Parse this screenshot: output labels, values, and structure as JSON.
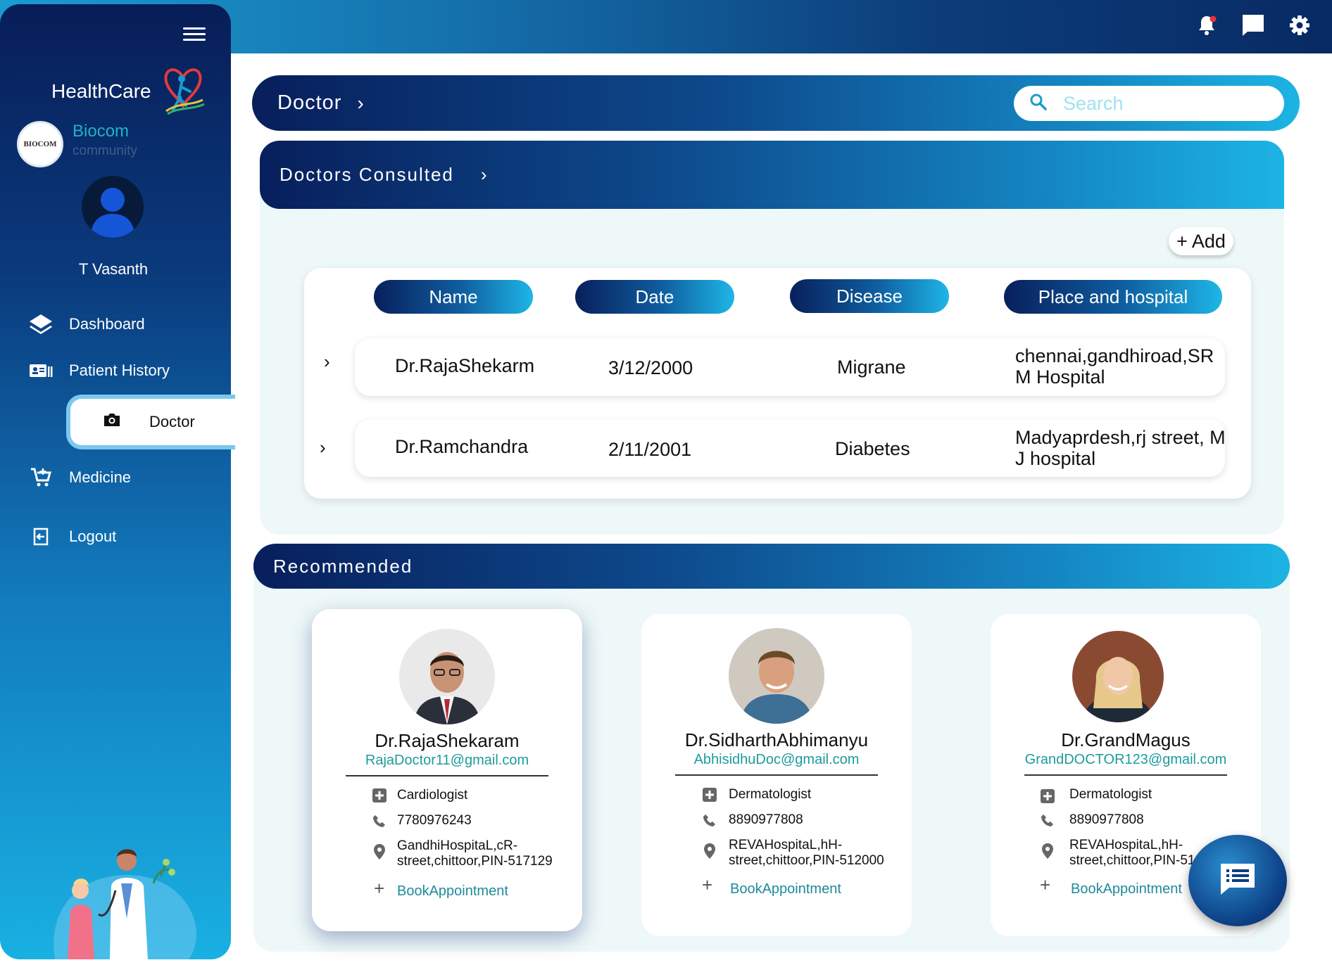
{
  "sidebar": {
    "brand": "HealthCare",
    "org_logo_text": "BIOCOM",
    "org_name": "Biocom",
    "org_sub": "community",
    "user_name": "T Vasanth",
    "nav": [
      {
        "label": "Dashboard",
        "icon": "layers-icon"
      },
      {
        "label": "Patient History",
        "icon": "id-card-icon"
      },
      {
        "label": "Doctor",
        "icon": "camera-icon",
        "active": true
      },
      {
        "label": "Medicine",
        "icon": "cart-icon"
      },
      {
        "label": "Logout",
        "icon": "logout-icon"
      }
    ]
  },
  "topbar": {
    "icons": [
      "bell-icon",
      "chat-icon",
      "gear-icon"
    ]
  },
  "breadcrumb": {
    "title": "Doctor",
    "chevron": "›"
  },
  "search": {
    "placeholder": "Search"
  },
  "consulted": {
    "title": "Doctors Consulted",
    "chevron": "›",
    "add_label": "+ Add",
    "headers": [
      "Name",
      "Date",
      "Disease",
      "Place and hospital"
    ],
    "rows": [
      {
        "name": "Dr.RajaShekarm",
        "date": "3/12/2000",
        "disease": "Migrane",
        "place": "chennai,gandhiroad,SR M Hospital"
      },
      {
        "name": "Dr.Ramchandra",
        "date": "2/11/2001",
        "disease": "Diabetes",
        "place": "Madyaprdesh,rj street, M J hospital"
      }
    ]
  },
  "recommended": {
    "title": "Recommended",
    "doctors": [
      {
        "name": "Dr.RajaShekaram",
        "email": "RajaDoctor11@gmail.com",
        "specialty": "Cardiologist",
        "phone": "7780976243",
        "address": "GandhiHospitaL,cR-street,chittoor,PIN-517129",
        "book": "BookAppointment"
      },
      {
        "name": "Dr.SidharthAbhimanyu",
        "email": "AbhisidhuDoc@gmail.com",
        "specialty": "Dermatologist",
        "phone": "8890977808",
        "address": "REVAHospitaL,hH-street,chittoor,PIN-512000",
        "book": "BookAppointment"
      },
      {
        "name": "Dr.GrandMagus",
        "email": "GrandDOCTOR123@gmail.com",
        "specialty": "Dermatologist",
        "phone": "8890977808",
        "address": "REVAHospitaL,hH-street,chittoor,PIN-512000",
        "book": "BookAppointment"
      }
    ]
  },
  "colors": {
    "primary_dark": "#081f5c",
    "primary_light": "#1cb4e3",
    "accent_teal": "#1e9b9b",
    "notification_dot": "#e8333a"
  }
}
